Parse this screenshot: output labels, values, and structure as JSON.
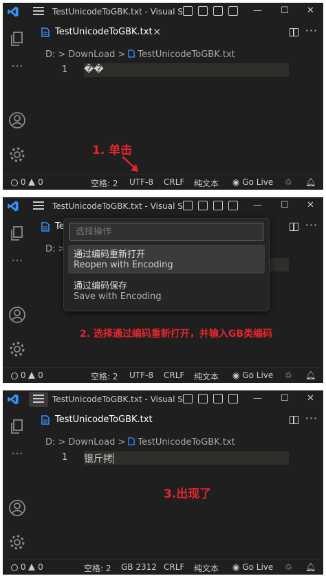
{
  "window_title": "TestUnicodeToGBK.txt - Visual S...",
  "tab_label": "TestUnicodeToGBK.txt",
  "tab_close": "×",
  "breadcrumb": {
    "drive": "D:",
    "folder": "DownLoad",
    "file": "TestUnicodeToGBK.txt",
    "sep": ">"
  },
  "line_number": "1",
  "window_controls": {
    "minimize": "—",
    "maximize": "☐",
    "close": "✕"
  },
  "more_actions": "···",
  "status": {
    "errors": "0",
    "warnings": "0",
    "indent": "空格: 2",
    "line_ending": "CRLF",
    "language": "纯文本",
    "golive": "Go Live"
  },
  "panels": [
    {
      "code_text": "��",
      "encoding": "UTF-8",
      "annotation": "1. 单击"
    },
    {
      "code_text": "",
      "encoding": "UTF-8",
      "annotation": "2. 选择通过编码重新打开，并输入GB类编码",
      "palette": {
        "placeholder": "选择操作",
        "items": [
          {
            "label": "通过编码重新打开",
            "detail": "Reopen with Encoding",
            "selected": true
          },
          {
            "label": "通过编码保存",
            "detail": "Save with Encoding",
            "selected": false
          }
        ]
      }
    },
    {
      "code_text": "锟斤拷",
      "encoding": "GB 2312",
      "annotation": "3.出现了"
    }
  ],
  "colors": {
    "accent_blue": "#3794ff",
    "annotation_red": "#e5262d",
    "editor_bg": "#1f1f1f"
  }
}
